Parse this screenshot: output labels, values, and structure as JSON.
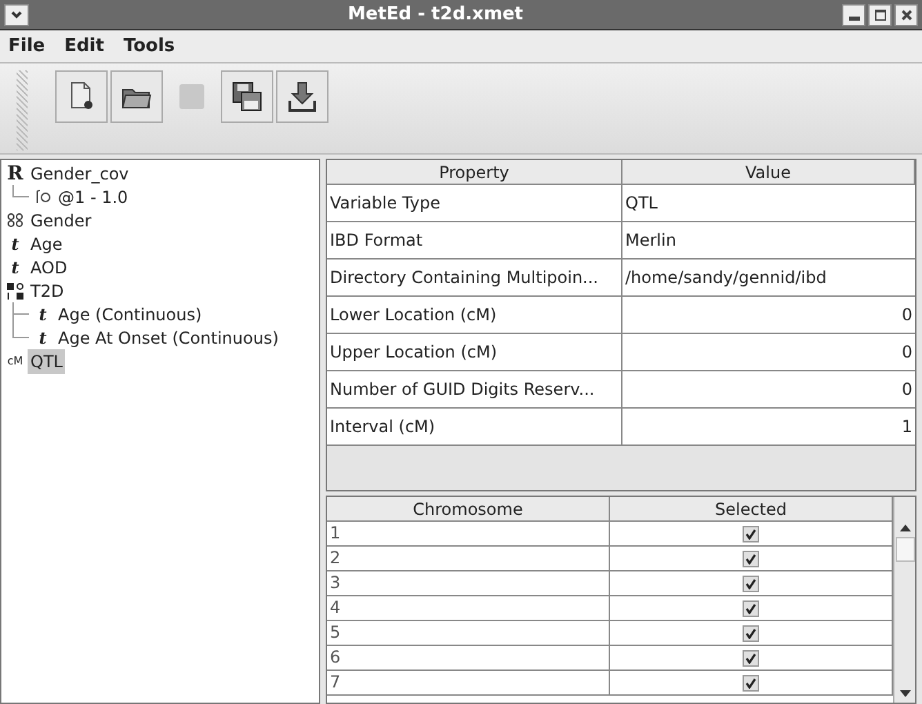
{
  "window": {
    "title": "MetEd - t2d.xmet"
  },
  "menu": [
    "File",
    "Edit",
    "Tools"
  ],
  "toolbar": [
    {
      "kind": "new",
      "disabled": false
    },
    {
      "kind": "open",
      "disabled": false
    },
    {
      "kind": "save",
      "disabled": true
    },
    {
      "kind": "save-as",
      "disabled": false
    },
    {
      "kind": "export",
      "disabled": false
    }
  ],
  "tree": [
    {
      "kind": "covariate",
      "glyph": "R",
      "label": "Gender_cov",
      "selected": false,
      "children": [
        {
          "kind": "function",
          "label": "@1 - 1.0",
          "selected": false
        }
      ]
    },
    {
      "kind": "categorical",
      "label": "Gender",
      "selected": false
    },
    {
      "kind": "continuous",
      "glyph": "t",
      "label": "Age",
      "selected": false
    },
    {
      "kind": "continuous",
      "glyph": "t",
      "label": "AOD",
      "selected": false
    },
    {
      "kind": "affection",
      "label": "T2D",
      "selected": false,
      "children": [
        {
          "kind": "continuous",
          "glyph": "t",
          "label": "Age (Continuous)",
          "selected": false
        },
        {
          "kind": "continuous",
          "glyph": "t",
          "label": "Age At Onset (Continuous)",
          "selected": false
        }
      ]
    },
    {
      "kind": "qtl",
      "glyph": "cM",
      "label": "QTL",
      "selected": true
    }
  ],
  "properties": {
    "columns": [
      "Property",
      "Value"
    ],
    "rows": [
      {
        "property": "Variable Type",
        "value": "QTL",
        "kind": "text"
      },
      {
        "property": "IBD Format",
        "value": "Merlin",
        "kind": "text"
      },
      {
        "property": "Directory Containing Multipoin...",
        "value": "/home/sandy/gennid/ibd",
        "kind": "text"
      },
      {
        "property": "Lower Location (cM)",
        "value": "0",
        "kind": "number"
      },
      {
        "property": "Upper Location (cM)",
        "value": "0",
        "kind": "number"
      },
      {
        "property": "Number of GUID Digits Reserv...",
        "value": "0",
        "kind": "number"
      },
      {
        "property": "Interval (cM)",
        "value": "1",
        "kind": "number"
      }
    ]
  },
  "chromosomes": {
    "columns": [
      "Chromosome",
      "Selected"
    ],
    "rows": [
      {
        "chromosome": "1",
        "checked": true
      },
      {
        "chromosome": "2",
        "checked": true
      },
      {
        "chromosome": "3",
        "checked": true
      },
      {
        "chromosome": "4",
        "checked": true
      },
      {
        "chromosome": "5",
        "checked": true
      },
      {
        "chromosome": "6",
        "checked": true
      },
      {
        "chromosome": "7",
        "checked": true
      }
    ]
  }
}
